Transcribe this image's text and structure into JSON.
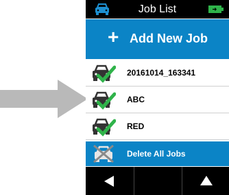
{
  "header": {
    "title": "Job List",
    "car_icon": "car-icon",
    "battery_icon": "battery-icon"
  },
  "add_job": {
    "icon": "plus-icon",
    "label": "Add New Job"
  },
  "jobs": [
    {
      "name": "20161014_163341",
      "icon": "car-check-icon"
    },
    {
      "name": "ABC",
      "icon": "car-check-icon"
    },
    {
      "name": "RED",
      "icon": "car-check-icon"
    }
  ],
  "delete_all": {
    "icon": "car-delete-icon",
    "label": "Delete All Jobs"
  },
  "footer": {
    "buttons": [
      {
        "icon": "left-arrow-icon"
      },
      {
        "icon": "blank"
      },
      {
        "icon": "up-arrow-icon"
      }
    ]
  },
  "colors": {
    "accent": "#0b84c6",
    "header_bg": "#000000",
    "check": "#2fb34a",
    "pointer": "#b9b9b9"
  }
}
